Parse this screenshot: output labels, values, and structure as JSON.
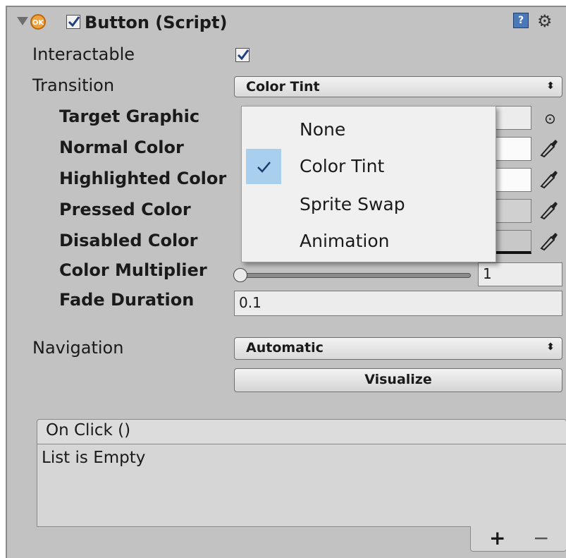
{
  "component": {
    "title": "Button (Script)",
    "enabled": true,
    "icon_badge": "OK"
  },
  "fields": {
    "interactable": {
      "label": "Interactable",
      "checked": true
    },
    "transition": {
      "label": "Transition",
      "value": "Color Tint"
    },
    "target_graphic": {
      "label": "Target Graphic"
    },
    "normal_color": {
      "label": "Normal Color"
    },
    "highlighted_color": {
      "label": "Highlighted Color"
    },
    "pressed_color": {
      "label": "Pressed Color"
    },
    "disabled_color": {
      "label": "Disabled Color"
    },
    "color_multiplier": {
      "label": "Color Multiplier",
      "value": "1"
    },
    "fade_duration": {
      "label": "Fade Duration",
      "value": "0.1"
    },
    "navigation": {
      "label": "Navigation",
      "value": "Automatic"
    },
    "visualize_label": "Visualize"
  },
  "transition_menu": {
    "options": [
      "None",
      "Color Tint",
      "Sprite Swap",
      "Animation"
    ],
    "selected": "Color Tint"
  },
  "on_click": {
    "header": "On Click ()",
    "empty_text": "List is Empty",
    "add_label": "+",
    "remove_label": "−"
  },
  "icons": {
    "foldout": "triangle-down-icon",
    "script": "ok-button-icon",
    "help": "book-help-icon",
    "settings": "gear-icon",
    "picker": "eyedropper-icon",
    "object_picker": "target-circle-icon"
  }
}
